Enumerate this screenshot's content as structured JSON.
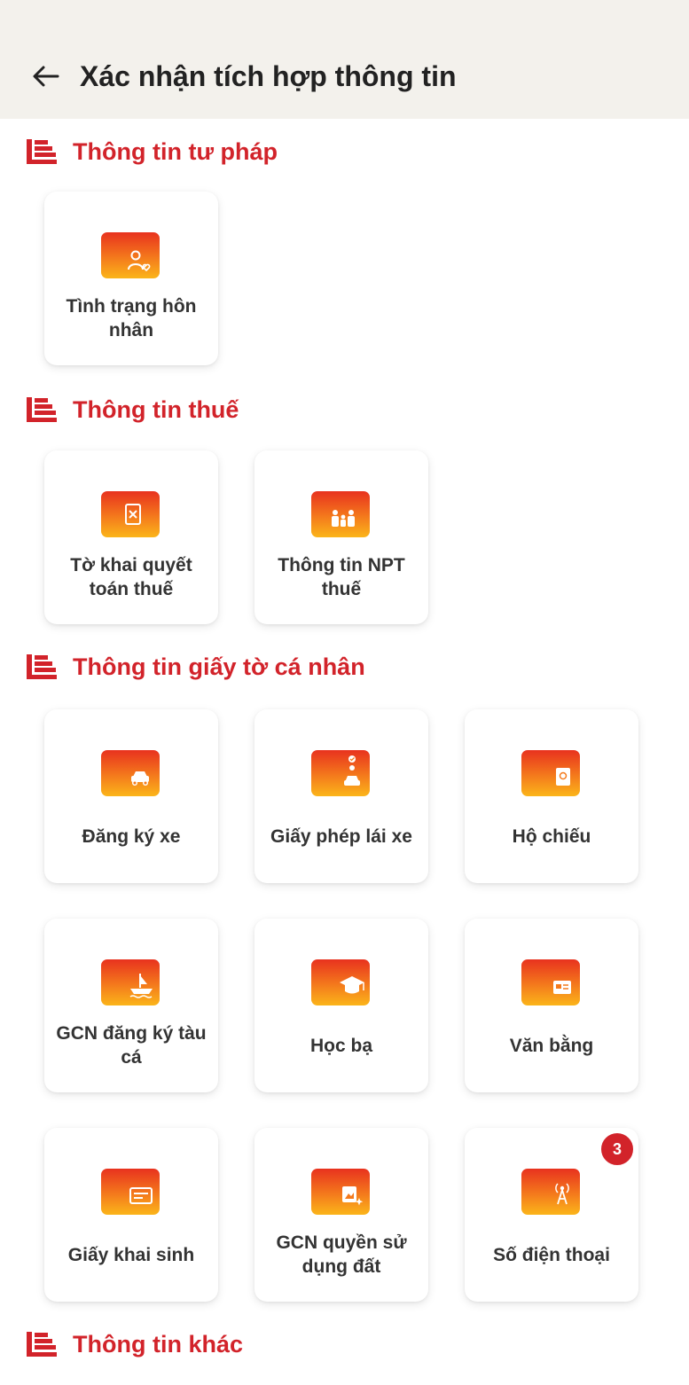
{
  "header": {
    "title": "Xác nhận tích hợp thông tin",
    "back_icon": "arrow-left-icon"
  },
  "colors": {
    "accent": "#d2232a",
    "header_bg": "#f3f1ec",
    "icon_gradient_top": "#e8321e",
    "icon_gradient_bottom": "#fbb51a"
  },
  "sections": [
    {
      "title": "Thông tin tư pháp",
      "cards": [
        {
          "label": "Tình trạng hôn nhân",
          "icon": "person-heart-icon"
        }
      ]
    },
    {
      "title": "Thông tin thuế",
      "cards": [
        {
          "label": "Tờ khai quyết toán thuế",
          "icon": "tax-document-icon"
        },
        {
          "label": "Thông tin NPT thuế",
          "icon": "family-icon"
        }
      ]
    },
    {
      "title": "Thông tin giấy tờ cá nhân",
      "cards": [
        {
          "label": "Đăng ký xe",
          "icon": "car-icon"
        },
        {
          "label": "Giấy phép lái xe",
          "icon": "driver-license-icon"
        },
        {
          "label": "Hộ chiếu",
          "icon": "passport-icon"
        },
        {
          "label": "GCN đăng ký tàu cá",
          "icon": "fishing-boat-icon"
        },
        {
          "label": "Học bạ",
          "icon": "graduation-cap-icon"
        },
        {
          "label": "Văn bằng",
          "icon": "diploma-icon"
        },
        {
          "label": "Giấy khai sinh",
          "icon": "birth-certificate-icon"
        },
        {
          "label": "GCN quyền sử dụng đất",
          "icon": "land-certificate-icon"
        },
        {
          "label": "Số điện thoại",
          "icon": "antenna-icon",
          "badge": "3"
        }
      ]
    },
    {
      "title": "Thông tin khác",
      "cards": []
    }
  ]
}
